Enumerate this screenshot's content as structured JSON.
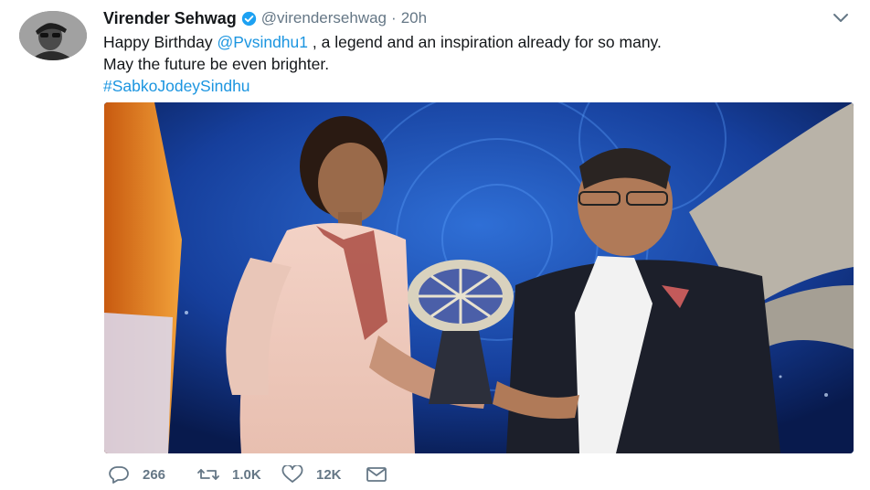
{
  "tweet": {
    "author_name": "Virender Sehwag",
    "author_handle": "@virendersehwag",
    "separator": "·",
    "timestamp": "20h",
    "text_part1": "Happy Birthday ",
    "mention": "@Pvsindhu1",
    "text_part2": " , a legend and an inspiration already for so many.",
    "text_line2": "May the future be even brighter.",
    "hashtag": "#SabkoJodeySindhu"
  },
  "actions": {
    "reply_count": "266",
    "retweet_count": "1.0K",
    "like_count": "12K"
  },
  "icons": {
    "verified": "verified-badge-icon",
    "caret": "chevron-down-icon",
    "reply": "reply-icon",
    "retweet": "retweet-icon",
    "like": "heart-icon",
    "message": "envelope-icon"
  },
  "colors": {
    "link": "#1b95e0",
    "muted": "#657786",
    "verified": "#1da1f2"
  }
}
